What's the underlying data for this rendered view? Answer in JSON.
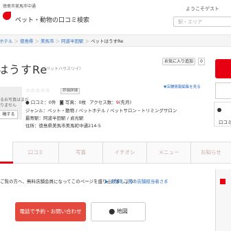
{
  "header": {
    "area_label": "徳島市美馬市中通",
    "site_title": "ペット・動物の口コミ検索",
    "welcome": "ようこそゲスト",
    "search_placeholder": "駅・エリア"
  },
  "breadcrumb": {
    "items": [
      "ホテル",
      "徳島県",
      "美馬市",
      "阿波半田駅"
    ],
    "current": "ペットはうすRe"
  },
  "shop": {
    "name": "はうすRe",
    "kana": "（ペットハウスリイ）",
    "favorite_label": "お気に入り追加",
    "favorite_count": "0",
    "owner_link": "▼店舗情報編集を見る"
  },
  "photo": {
    "line1": "るお写真はまだ",
    "line2": "りません",
    "button": "稿する"
  },
  "rating": {
    "stars": "☆☆☆☆☆",
    "badge": "評価詳細"
  },
  "stats": {
    "reviews_label": "口コミ：",
    "reviews": "0件",
    "photos_label": "写真：",
    "photos": "0枚",
    "access_label": "アクセス数：",
    "access": "9",
    "access_unit": "(先月)"
  },
  "info": {
    "genre": "ジャンル：ペット・動物 / ペットホテル / ペットサロン・トリミングサロン",
    "station": "最寄駅：阿波半田駅 / 貞光駅",
    "address": "住所：徳島県美馬市美馬町中通214-5"
  },
  "side": {
    "review_label": "口コミ"
  },
  "tabs": [
    "",
    "口コミ",
    "写真",
    "イチオシ",
    "メニュー",
    "お知らせ"
  ],
  "notice": {
    "text": "ご覧の方へ、無料店舗会員になってこのページを盛り上げましょう！",
    "link": "▶ 店舗をご覧の店舗担当者さま"
  },
  "actions": {
    "call": "電話で予約・お問い合わせ",
    "map": "地図"
  },
  "colors": {
    "brand_red": "#e60012",
    "link_blue": "#2a6fc9",
    "call_red": "#e4493d"
  }
}
